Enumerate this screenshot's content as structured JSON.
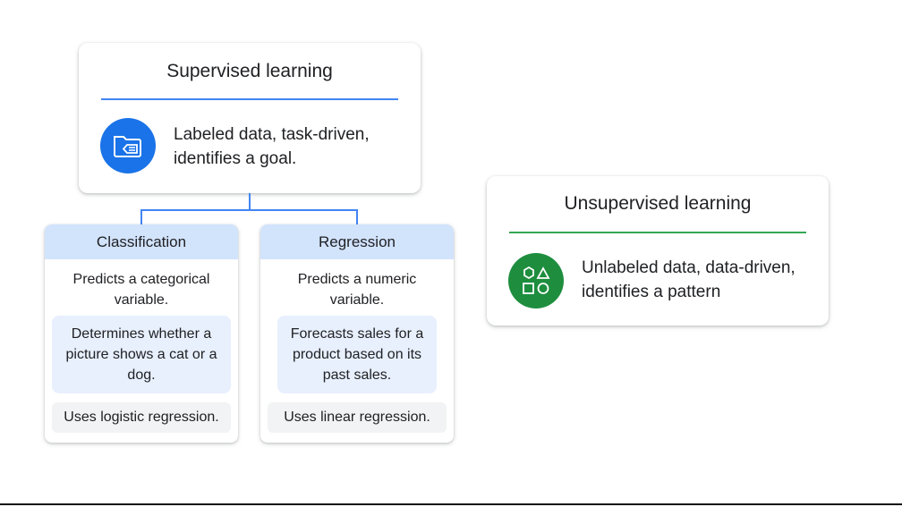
{
  "supervised": {
    "title": "Supervised learning",
    "description": "Labeled data, task-driven, identifies a goal.",
    "icon": "labeled-folder-icon",
    "accent": "#4285f4",
    "icon_bg": "#1a73e8"
  },
  "classification": {
    "title": "Classification",
    "summary": "Predicts a categorical variable.",
    "example": "Determines whether a picture shows a cat or a dog.",
    "method": "Uses logistic regression."
  },
  "regression": {
    "title": "Regression",
    "summary": "Predicts a numeric variable.",
    "example": "Forecasts sales for a product based on its past sales.",
    "method": "Uses linear regression."
  },
  "unsupervised": {
    "title": "Unsupervised learning",
    "description": "Unlabeled data, data-driven, identifies a pattern",
    "icon": "shapes-icon",
    "accent": "#34a853",
    "icon_bg": "#1e8e3e"
  }
}
